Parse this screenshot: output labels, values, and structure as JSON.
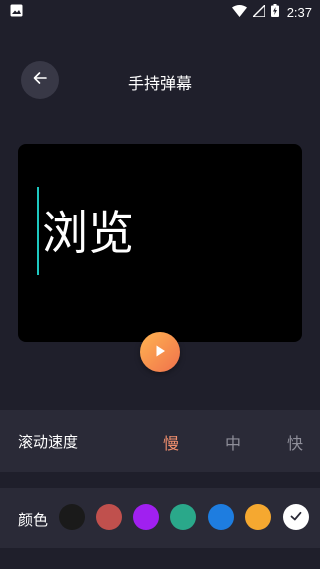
{
  "status_bar": {
    "time": "2:37",
    "icons": [
      "image-icon",
      "wifi-icon",
      "signal-icon",
      "battery-charging-icon"
    ]
  },
  "header": {
    "title": "手持弹幕",
    "back_icon": "arrow-left-icon"
  },
  "preview": {
    "text": "浏览",
    "cursor_color": "#1ec8c0",
    "play_icon": "play-icon",
    "play_colors": [
      "#ffb451",
      "#f0714c"
    ]
  },
  "speed": {
    "label": "滚动速度",
    "options": [
      "慢",
      "中",
      "快"
    ],
    "selected": "慢",
    "active_color": "#f08f6e"
  },
  "color": {
    "label": "颜色",
    "swatches": [
      "#1a1a1a",
      "#c0504d",
      "#a020f0",
      "#2aa88a",
      "#1e7de0",
      "#f5a830",
      "#ffffff"
    ],
    "selected_index": 6
  }
}
